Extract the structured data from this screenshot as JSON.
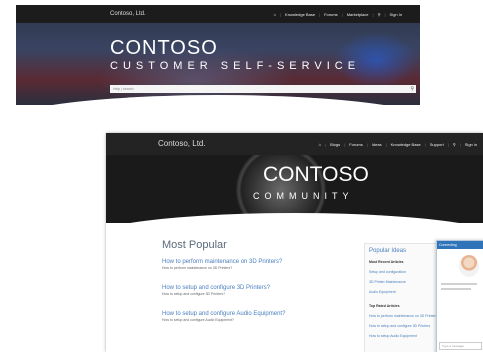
{
  "top": {
    "brand": "Contoso, Ltd.",
    "nav": [
      "Knowledge Base",
      "Forums",
      "Marketplace",
      "Sign In"
    ],
    "title": "CONTOSO",
    "subtitle": "CUSTOMER SELF-SERVICE",
    "search_placeholder": "Help | search"
  },
  "bottom": {
    "brand": "Contoso, Ltd.",
    "nav": [
      "Blogs",
      "Forums",
      "Ideas",
      "Knowledge Base",
      "Support",
      "Sign in"
    ],
    "title": "CONTOSO",
    "subtitle": "COMMUNITY",
    "most_popular": {
      "heading": "Most Popular",
      "items": [
        {
          "title": "How to perform maintenance on 3D Printers?",
          "desc": "How to perform maintenance on 3D Printers?"
        },
        {
          "title": "How to setup and configure 3D Printers?",
          "desc": "How to setup and configure 3D Printers?"
        },
        {
          "title": "How to setup and configure Audio Equipment?",
          "desc": "How to setup and configure Audio Equipment?"
        }
      ]
    },
    "sidebar": {
      "heading": "Popular Ideas",
      "section1": "Most Recent Articles",
      "items1": [
        "Setup and configuration",
        "3D Printer Maintenance",
        "Audio Equipment"
      ],
      "section2": "Top Rated Articles",
      "items2": [
        "How to perform maintenance on 3D Printers?",
        "How to setup and configure 3D Printers",
        "How to setup Audio Equipment"
      ]
    },
    "chat": {
      "header": "Connecting",
      "input_placeholder": "Type a message"
    }
  }
}
